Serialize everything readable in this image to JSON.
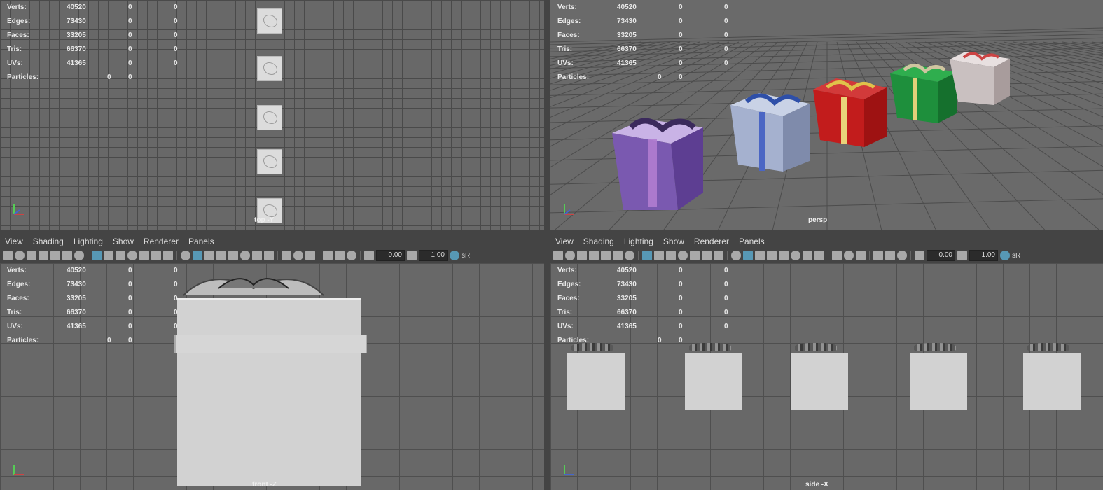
{
  "stats_rows": [
    {
      "label": "Verts:",
      "a": "40520",
      "b": "0",
      "c": "0"
    },
    {
      "label": "Edges:",
      "a": "73430",
      "b": "0",
      "c": "0"
    },
    {
      "label": "Faces:",
      "a": "33205",
      "b": "0",
      "c": "0"
    },
    {
      "label": "Tris:",
      "a": "66370",
      "b": "0",
      "c": "0"
    },
    {
      "label": "UVs:",
      "a": "41365",
      "b": "0",
      "c": "0"
    }
  ],
  "particles": {
    "label": "Particles:",
    "a": "0",
    "b": "0"
  },
  "viewports": {
    "top": {
      "label": "top -Y"
    },
    "persp": {
      "label": "persp"
    },
    "front": {
      "label": "front -Z"
    },
    "side": {
      "label": "side -X"
    }
  },
  "menu": [
    "View",
    "Shading",
    "Lighting",
    "Show",
    "Renderer",
    "Panels"
  ],
  "toolbar": {
    "exposure": "0.00",
    "gamma": "1.00",
    "colorspace": "sR"
  },
  "colors": {
    "accent": "#5aa7c9",
    "viewport_bg": "#686868",
    "grid": "#4a4a4a",
    "ui_bg": "#444444"
  }
}
